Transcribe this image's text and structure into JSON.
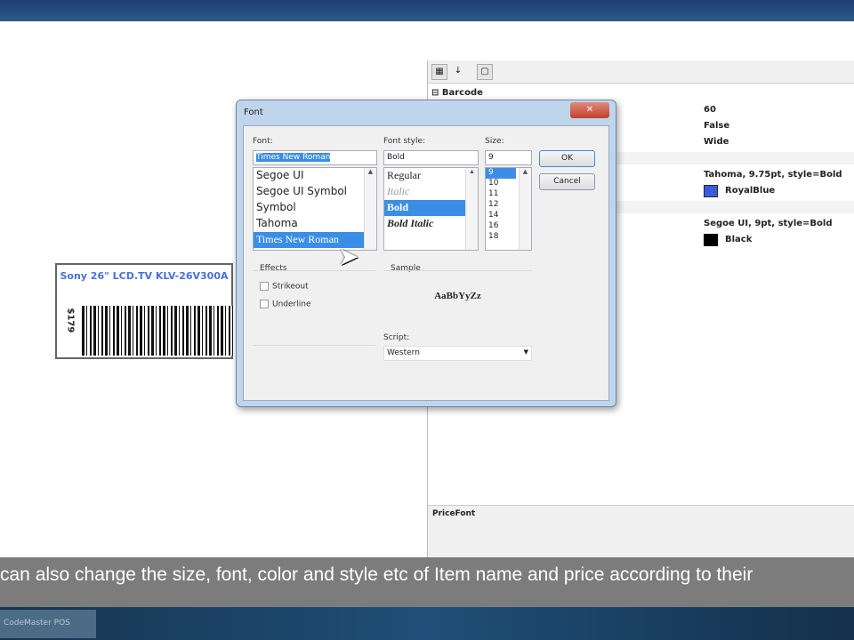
{
  "properties": {
    "category": "Barcode",
    "values": [
      "60",
      "False",
      "Wide"
    ],
    "name_font": "Tahoma, 9.75pt, style=Bold",
    "name_color": {
      "label": "RoyalBlue",
      "hex": "#3b5bd9"
    },
    "price_font": "Segoe UI, 9pt, style=Bold",
    "price_color": {
      "label": "Black",
      "hex": "#000000"
    },
    "description_title": "PriceFont"
  },
  "barcode_label": {
    "item_name": "Sony 26\" LCD.TV KLV-26V300A",
    "price": "$179"
  },
  "font_dialog": {
    "title": "Font",
    "font_label": "Font:",
    "font_value": "Times New Roman",
    "fonts": [
      "Segoe UI",
      "Segoe UI Symbol",
      "Symbol",
      "Tahoma",
      "Times New Roman"
    ],
    "style_label": "Font style:",
    "style_value": "Bold",
    "styles": [
      "Regular",
      "Italic",
      "Bold",
      "Bold Italic"
    ],
    "size_label": "Size:",
    "size_value": "9",
    "sizes": [
      "9",
      "10",
      "11",
      "12",
      "14",
      "16",
      "18"
    ],
    "ok": "OK",
    "cancel": "Cancel",
    "effects_label": "Effects",
    "strikeout": "Strikeout",
    "underline": "Underline",
    "sample_label": "Sample",
    "sample_text": "AaBbYyZz",
    "script_label": "Script:",
    "script_value": "Western"
  },
  "subtitle": "can also change the size, font, color and style etc of Item name and price according to their",
  "taskbar": {
    "app": "CodeMaster POS"
  }
}
